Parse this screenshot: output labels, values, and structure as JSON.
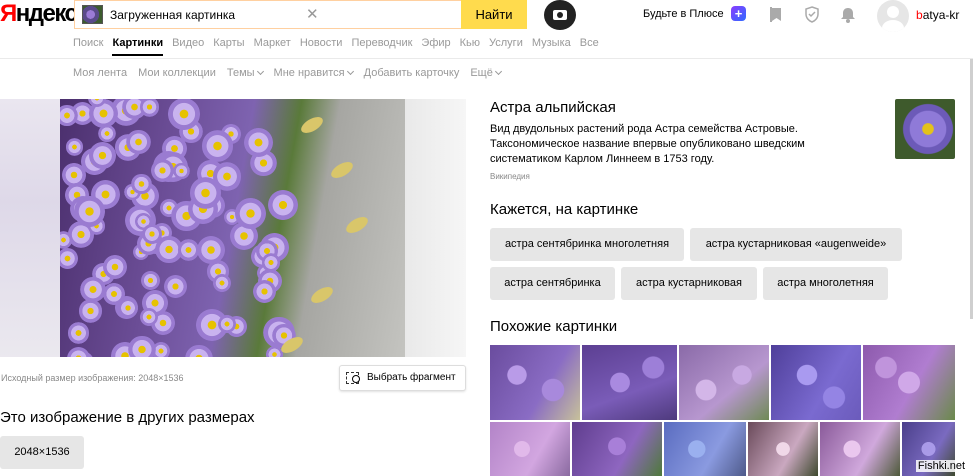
{
  "header": {
    "logo": "Яндекс",
    "search": {
      "query": "Загруженная картинка",
      "clear_icon": "close-icon"
    },
    "search_button": "Найти",
    "plus_link": "Будьте в Плюсе",
    "plus_badge": "+",
    "user": {
      "name": "batya-kr"
    }
  },
  "services": [
    "Поиск",
    "Картинки",
    "Видео",
    "Карты",
    "Маркет",
    "Новости",
    "Переводчик",
    "Эфир",
    "Кью",
    "Услуги",
    "Музыка",
    "Все"
  ],
  "subnav": {
    "feed": "Моя лента",
    "collections": "Мои коллекции",
    "themes": "Темы",
    "likes": "Мне нравится",
    "add_card": "Добавить карточку",
    "more": "Ещё"
  },
  "image": {
    "original_size": "Исходный размер изображения: 2048×1536",
    "fragment_button": "Выбрать фрагмент"
  },
  "other_sizes": {
    "title": "Это изображение в других размерах",
    "sizes": [
      "2048×1536"
    ]
  },
  "object": {
    "title": "Астра альпийская",
    "description": "Вид двудольных растений рода Астра семейства Астровые. Таксономическое название впервые опубликовано шведским систематиком Карлом Линнеем в 1753 году.",
    "source": "Википедия"
  },
  "tags": {
    "title": "Кажется, на картинке",
    "items": [
      "астра сентябринка многолетняя",
      "астра кустарниковая «augenweide»",
      "астра сентябринка",
      "астра кустарниковая",
      "астра многолетняя"
    ]
  },
  "similar": {
    "title": "Похожие картинки"
  },
  "watermark": "Fishki.net",
  "colors": {
    "search_button": "#ffdb4d",
    "logo_accent": "#ff0000",
    "chip": "#e6e6e6"
  }
}
